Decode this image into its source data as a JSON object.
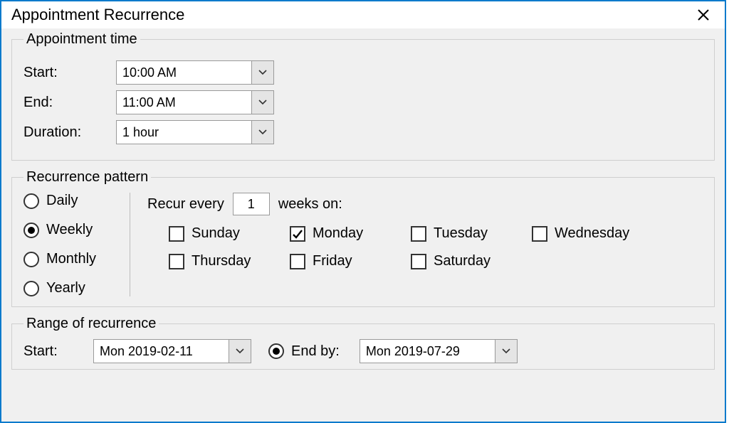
{
  "window": {
    "title": "Appointment Recurrence"
  },
  "appointment_time": {
    "legend": "Appointment time",
    "start_label": "Start:",
    "start_value": "10:00 AM",
    "end_label": "End:",
    "end_value": "11:00 AM",
    "duration_label": "Duration:",
    "duration_value": "1 hour"
  },
  "recurrence_pattern": {
    "legend": "Recurrence pattern",
    "frequencies": {
      "daily": {
        "label": "Daily",
        "selected": false
      },
      "weekly": {
        "label": "Weekly",
        "selected": true
      },
      "monthly": {
        "label": "Monthly",
        "selected": false
      },
      "yearly": {
        "label": "Yearly",
        "selected": false
      }
    },
    "recur_every_prefix": "Recur every",
    "recur_every_value": "1",
    "recur_every_suffix": "weeks on:",
    "days": {
      "sunday": {
        "label": "Sunday",
        "checked": false
      },
      "monday": {
        "label": "Monday",
        "checked": true
      },
      "tuesday": {
        "label": "Tuesday",
        "checked": false
      },
      "wednesday": {
        "label": "Wednesday",
        "checked": false
      },
      "thursday": {
        "label": "Thursday",
        "checked": false
      },
      "friday": {
        "label": "Friday",
        "checked": false
      },
      "saturday": {
        "label": "Saturday",
        "checked": false
      }
    }
  },
  "range": {
    "legend": "Range of recurrence",
    "start_label": "Start:",
    "start_value": "Mon 2019-02-11",
    "end_by": {
      "label": "End by:",
      "selected": true
    },
    "end_by_value": "Mon 2019-07-29"
  }
}
